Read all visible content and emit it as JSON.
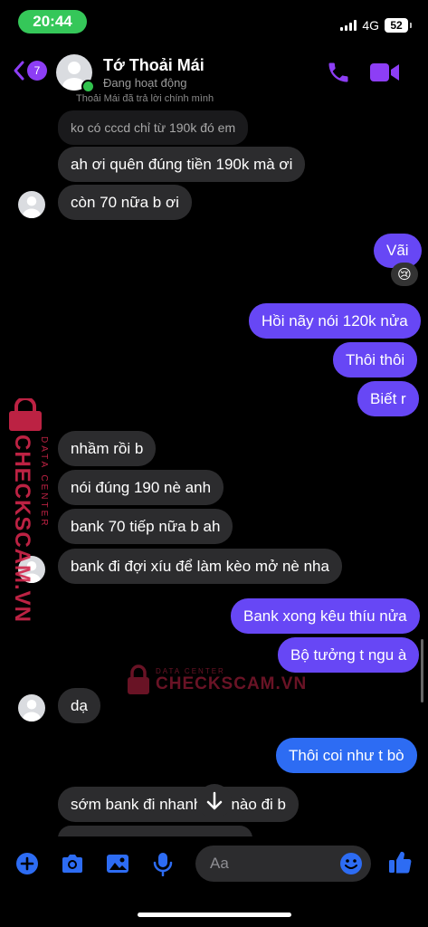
{
  "status_bar": {
    "time": "20:44",
    "network": "4G",
    "battery": "52"
  },
  "header": {
    "back_count": "7",
    "contact_name": "Tớ Thoải Mái",
    "contact_status": "Đang hoạt động",
    "reply_note": "Thoải Mái đã trả lời chính mình"
  },
  "messages": {
    "quoted": "ko có cccd chỉ từ 190k đó em",
    "m1": "ah ơi quên đúng tiền 190k mà ơi",
    "m2": "còn 70 nữa b ơi",
    "m3": "Vãi",
    "m3_reaction": "😢",
    "m4": "Hồi nãy nói 120k nửa",
    "m5": "Thôi thôi",
    "m6": "Biết r",
    "m7": "nhầm rồi b",
    "m8": "nói đúng 190 nè anh",
    "m9": "bank 70 tiếp nữa b ah",
    "m10": "bank đi đợi xíu để làm kèo mở nè nha",
    "m11": "Bank xong kêu thíu nửa",
    "m12": "Bộ tưởng t ngu à",
    "m13": "dạ",
    "m14": "Thôi coi như t bò",
    "m15": "sớm bank đi nhanh lên nào đi b"
  },
  "watermark": {
    "brand": "CHECKSCAM.VN",
    "tag": "DATA CENTER"
  },
  "composer": {
    "placeholder": "Aa"
  },
  "colors": {
    "outgoing_purple": "#6747f5",
    "outgoing_blue": "#2d6cf3",
    "incoming": "#2c2c2e",
    "accent": "#8d3ef5",
    "watermark": "#d1264b"
  },
  "icons": [
    "back-chevron-icon",
    "phone-icon",
    "video-camera-icon",
    "plus-icon",
    "camera-icon",
    "gallery-icon",
    "microphone-icon",
    "emoji-icon",
    "thumbs-up-icon",
    "arrow-down-icon"
  ]
}
